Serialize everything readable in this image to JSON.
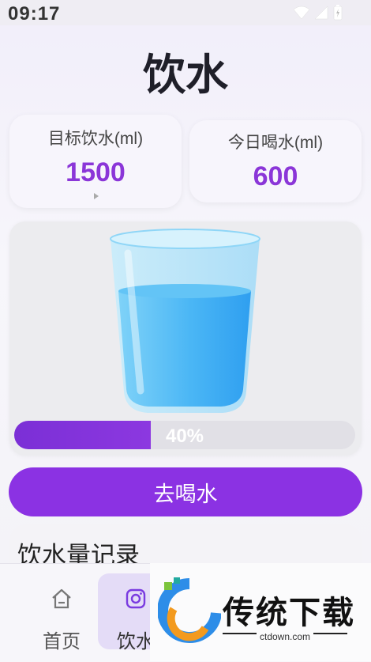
{
  "status_bar": {
    "time": "09:17"
  },
  "page": {
    "title": "饮水"
  },
  "goal_card": {
    "label": "目标饮水(ml)",
    "value": "1500"
  },
  "today_card": {
    "label": "今日喝水(ml)",
    "value": "600"
  },
  "progress": {
    "fraction": 0.4,
    "text": "40%"
  },
  "drink_button": {
    "label": "去喝水"
  },
  "records": {
    "title": "饮水量记录"
  },
  "tabs": [
    {
      "label": "首页",
      "icon": "home-icon"
    },
    {
      "label": "饮水",
      "icon": "camera-icon"
    }
  ],
  "watermark": {
    "text": "传统下载",
    "url": "ctdown.com"
  },
  "colors": {
    "accent": "#8b32e3",
    "value_text": "#8b36d8",
    "water": "#4cb8f5"
  }
}
